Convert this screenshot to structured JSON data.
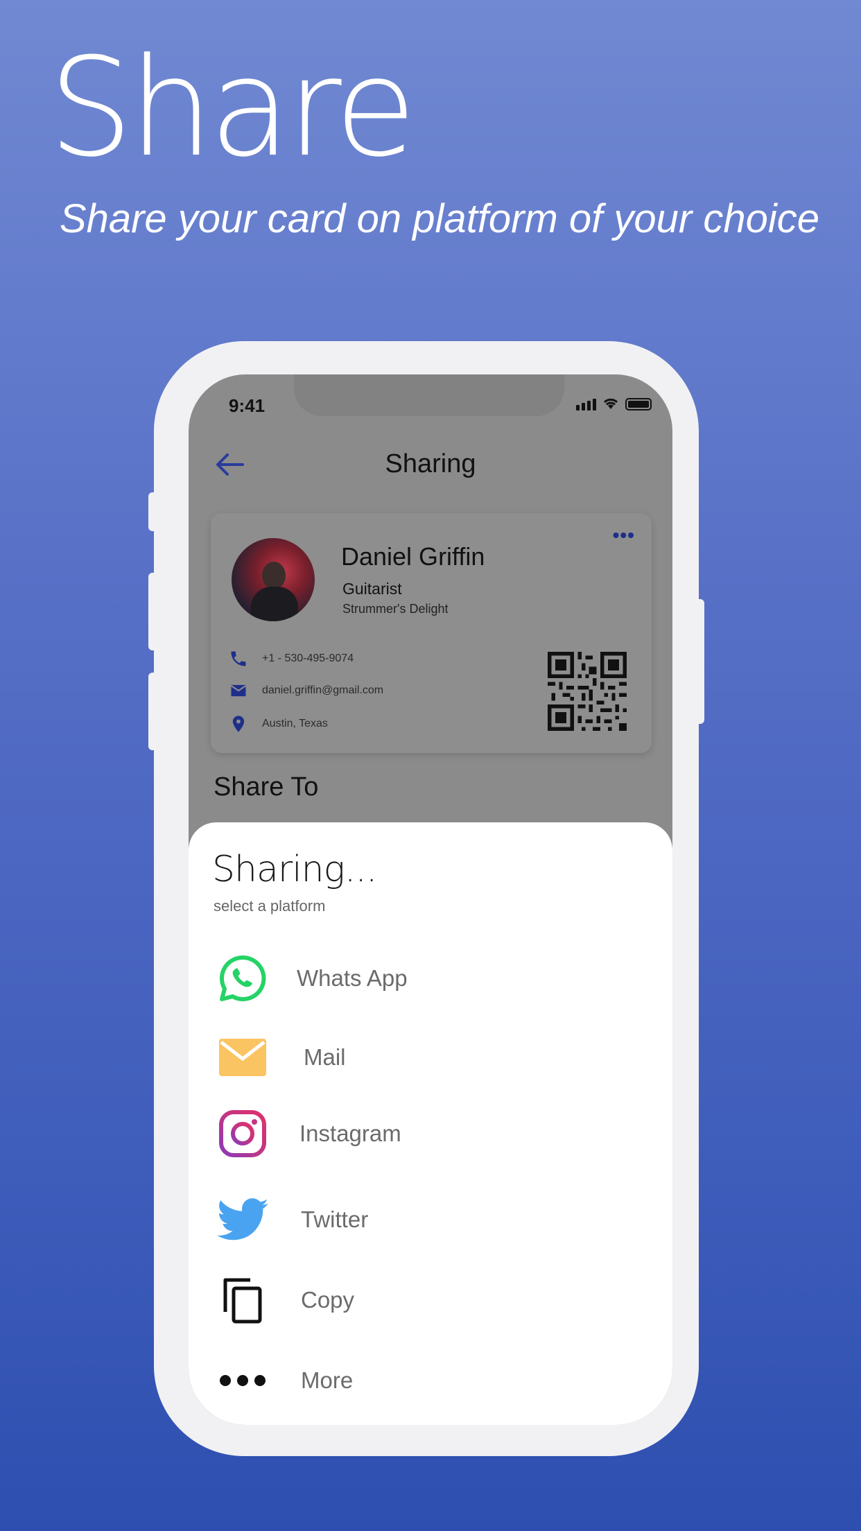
{
  "hero": {
    "title": "Share",
    "subtitle": "Share your card on platform of your choice"
  },
  "status_bar": {
    "time": "9:41"
  },
  "nav": {
    "title": "Sharing"
  },
  "card": {
    "name": "Daniel Griffin",
    "role": "Guitarist",
    "company": "Strummer's Delight",
    "phone": "+1 - 530-495-9074",
    "email": "daniel.griffin@gmail.com",
    "location": "Austin, Texas",
    "more_label": "•••"
  },
  "share_to_label": "Share To",
  "sheet": {
    "title": "Sharing...",
    "subtitle": "select a platform",
    "options": [
      {
        "label": "Whats App",
        "icon": "whatsapp-icon",
        "color": "#25d366"
      },
      {
        "label": "Mail",
        "icon": "mail-icon",
        "color": "#fbc462"
      },
      {
        "label": "Instagram",
        "icon": "instagram-icon",
        "color": "#c13584"
      },
      {
        "label": "Twitter",
        "icon": "twitter-icon",
        "color": "#4aa3f0"
      },
      {
        "label": "Copy",
        "icon": "copy-icon",
        "color": "#111111"
      },
      {
        "label": "More",
        "icon": "more-icon",
        "color": "#111111"
      }
    ]
  },
  "colors": {
    "background_top": "#7189d2",
    "background_bottom": "#2e4fb0",
    "accent": "#1e2f8a"
  }
}
